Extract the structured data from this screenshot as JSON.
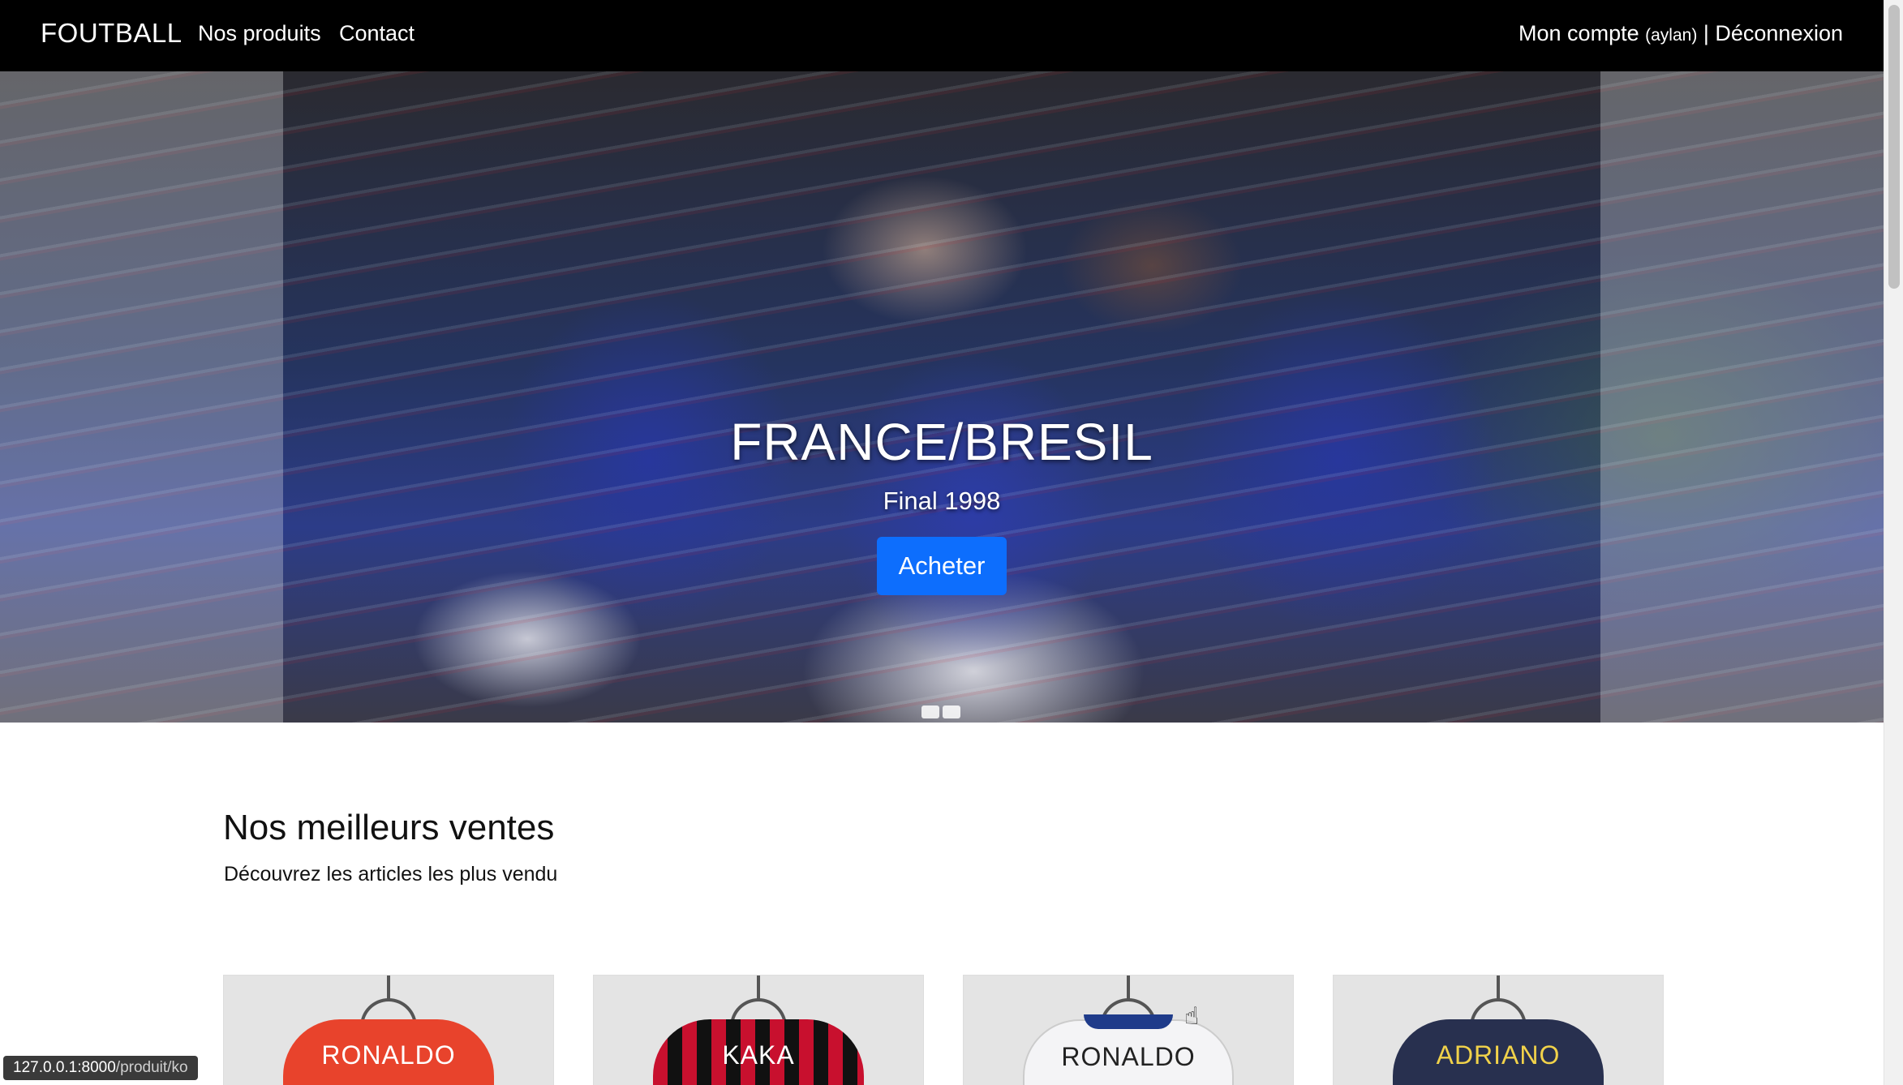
{
  "navbar": {
    "brand": "FOUTBALL",
    "links": [
      "Nos produits",
      "Contact"
    ],
    "account_label": "Mon compte",
    "account_user": "(aylan)",
    "separator": "|",
    "logout_label": "Déconnexion"
  },
  "hero": {
    "title": "FRANCE/BRESIL",
    "subtitle": "Final 1998",
    "button_label": "Acheter",
    "slides_count": 2
  },
  "bestsellers": {
    "title": "Nos meilleurs ventes",
    "subtitle": "Découvrez les articles les plus vendu",
    "products": [
      {
        "name_on_shirt": "RONALDO",
        "color": "#e8432c"
      },
      {
        "name_on_shirt": "KAKA",
        "color": "#c8102e"
      },
      {
        "name_on_shirt": "RONALDO",
        "color": "#f4f4f6"
      },
      {
        "name_on_shirt": "ADRIANO",
        "color": "#28304f"
      }
    ]
  },
  "status_bar": {
    "url_host": "127.0.0.1:8000",
    "url_path": "/produit/ko"
  },
  "colors": {
    "navbar_bg": "#000000",
    "primary_button": "#0d6efd"
  }
}
